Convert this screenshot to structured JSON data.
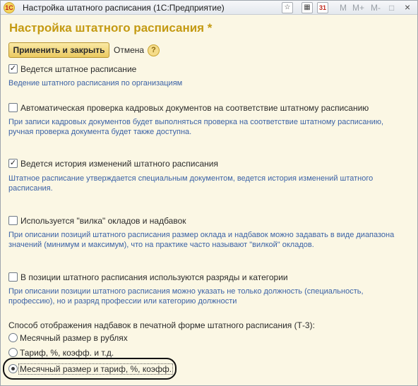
{
  "window": {
    "title": "Настройка штатного расписания  (1С:Предприятие)",
    "logo_text": "1С",
    "toolbar_icons": [
      "star-icon",
      "calculator-icon",
      "calendar-icon"
    ],
    "calendar_day": "31",
    "toolbar_text": [
      "M",
      "M+",
      "M-",
      "□",
      "×"
    ]
  },
  "form": {
    "title": "Настройка штатного расписания *",
    "apply_label": "Применить и закрыть",
    "cancel_label": "Отмена",
    "help_label": "?"
  },
  "options": [
    {
      "checked": true,
      "label": "Ведется штатное расписание",
      "description": "Ведение штатного расписания по организациям"
    },
    {
      "checked": false,
      "label": "Автоматическая проверка кадровых документов на соответствие штатному расписанию",
      "description": "При записи кадровых документов будет выполняться проверка на соответствие штатному расписанию, ручная проверка документа будет также доступна."
    },
    {
      "checked": true,
      "label": "Ведется история изменений штатного расписания",
      "description": "Штатное расписание утверждается специальным документом, ведется история изменений штатного расписания."
    },
    {
      "checked": false,
      "label": "Используется \"вилка\" окладов и надбавок",
      "description": "При описании позиций штатного расписания размер оклада и надбавок можно задавать в виде диапазона значений (минимум и максимум), что на практике часто называют \"вилкой\" окладов."
    },
    {
      "checked": false,
      "label": "В позиции штатного расписания используются разряды и категории",
      "description": "При описании позиции штатного расписания можно указать не только должность (специальность, профессию), но и разряд профессии или категорию должности"
    }
  ],
  "display_method": {
    "label": "Способ отображения надбавок в печатной форме штатного расписания (Т-3):",
    "choices": [
      {
        "label": "Месячный размер в рублях",
        "selected": false
      },
      {
        "label": "Тариф, %, коэфф. и т.д.",
        "selected": false
      },
      {
        "label": "Месячный размер и тариф, %, коэфф.",
        "selected": true
      }
    ]
  }
}
